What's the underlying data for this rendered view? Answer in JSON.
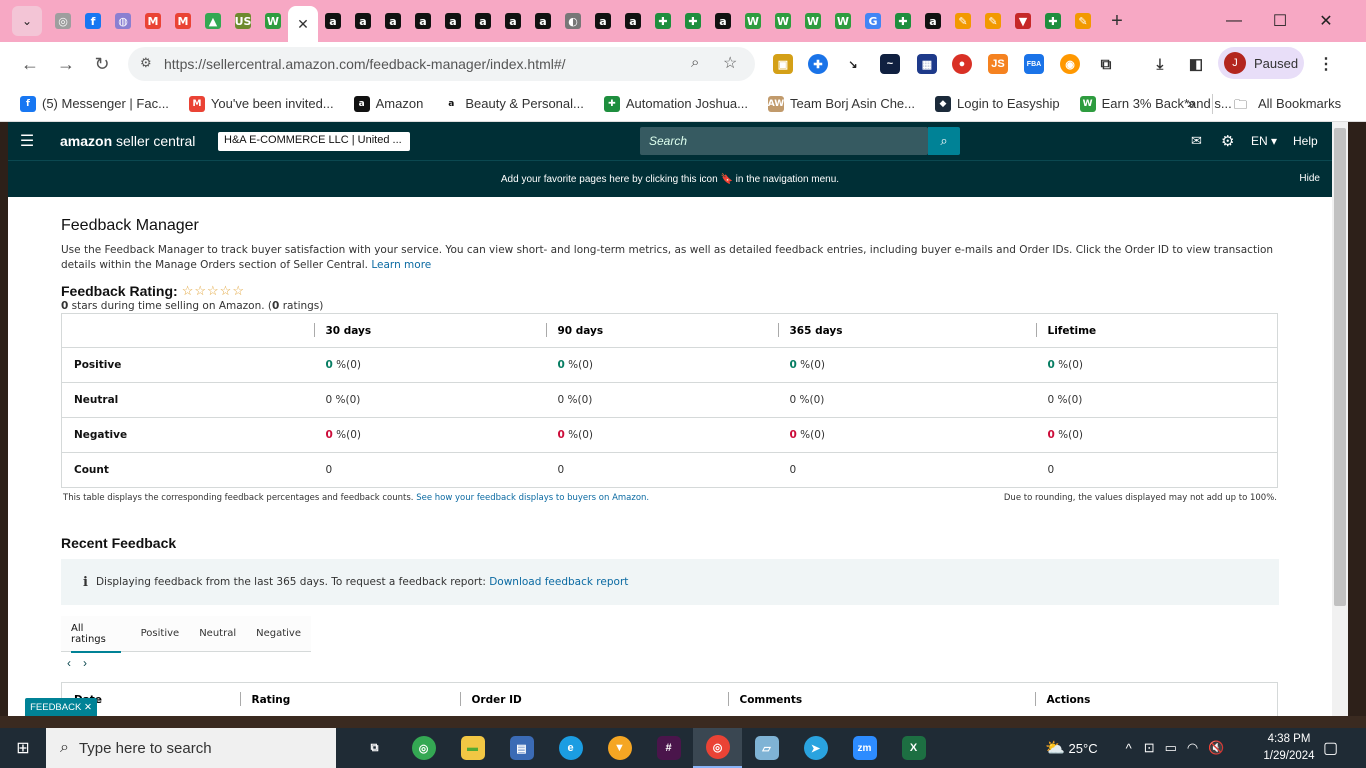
{
  "browser": {
    "tab_icons": [
      "chrome",
      "facebook",
      "messenger",
      "gmail",
      "gmail",
      "drive",
      "usfoods",
      "wealthy",
      "amazon",
      "amazon",
      "amazon",
      "amazon",
      "amazon",
      "amazon",
      "amazon",
      "amazon",
      "globe",
      "amazon",
      "amazon",
      "sheets",
      "sheets",
      "amazon",
      "wealthy",
      "wealthy",
      "wealthy",
      "wealthy",
      "google",
      "sheets",
      "amazon",
      "pencil",
      "pencil",
      "vpn",
      "sheets",
      "pencil"
    ],
    "active_tab_close": "✕",
    "new_tab": "+",
    "url": "https://sellercentral.amazon.com/feedback-manager/index.html#/",
    "profile_initial": "J",
    "profile_status": "Paused",
    "bookmarks": [
      {
        "icon": "facebook",
        "label": "(5) Messenger | Fac..."
      },
      {
        "icon": "gmail",
        "label": "You've been invited..."
      },
      {
        "icon": "amazon",
        "label": "Amazon"
      },
      {
        "icon": "amazon-smile",
        "label": "Beauty & Personal..."
      },
      {
        "icon": "sheets",
        "label": "Automation Joshua..."
      },
      {
        "icon": "team",
        "label": "Team Borj Asin Che..."
      },
      {
        "icon": "easyship",
        "label": "Login to Easyship"
      },
      {
        "icon": "wealthy",
        "label": "Earn 3% Back*and s..."
      }
    ],
    "all_bookmarks": "All Bookmarks",
    "more": "»"
  },
  "seller_central": {
    "logo_brand": "amazon",
    "logo_text": "seller central",
    "store": "H&A E-COMMERCE LLC | United ...",
    "search_placeholder": "Search",
    "language": "EN",
    "help": "Help",
    "fav_bar_text": "Add your favorite pages here by clicking this icon 🔖 in the navigation menu.",
    "fav_bar_hide": "Hide"
  },
  "feedback_manager": {
    "title": "Feedback Manager",
    "description": "Use the Feedback Manager to track buyer satisfaction with your service. You can view short- and long-term metrics, as well as detailed feedback entries, including buyer e-mails and Order IDs. Click the Order ID to view transaction details within the Manage Orders section of Seller Central.",
    "learn_more": "Learn more",
    "rating_label": "Feedback Rating:",
    "stars": "☆☆☆☆☆",
    "rating_count": "0",
    "rating_sub_text": " stars during time selling on Amazon. (",
    "ratings_num": "0",
    "ratings_word": " ratings)",
    "columns": [
      "",
      "30 days",
      "90 days",
      "365 days",
      "Lifetime"
    ],
    "rows": [
      {
        "label": "Positive",
        "values": [
          "0",
          "0",
          "0",
          "0"
        ],
        "suffix": " %(0)"
      },
      {
        "label": "Neutral",
        "values": [
          "0",
          "0",
          "0",
          "0"
        ],
        "suffix": " %(0)"
      },
      {
        "label": "Negative",
        "values": [
          "0",
          "0",
          "0",
          "0"
        ],
        "suffix": " %(0)"
      },
      {
        "label": "Count",
        "values": [
          "0",
          "0",
          "0",
          "0"
        ],
        "suffix": ""
      }
    ],
    "note_left": "This table displays the corresponding feedback percentages and feedback counts.",
    "note_left_link": "See how your feedback displays to buyers on Amazon.",
    "note_right": "Due to rounding, the values displayed may not add up to 100%.",
    "recent_title": "Recent Feedback",
    "info_text": "Displaying feedback from the last 365 days. To request a feedback report:",
    "info_link": "Download feedback report",
    "tabs": [
      "All ratings",
      "Positive",
      "Neutral",
      "Negative"
    ],
    "recent_columns": [
      "Date",
      "Rating",
      "Order ID",
      "Comments",
      "Actions"
    ],
    "feedback_tag": "FEEDBACK ✕"
  },
  "taskbar": {
    "search_placeholder": "Type here to search",
    "weather": "25°C",
    "time": "4:38 PM",
    "date": "1/29/2024"
  },
  "colors": {
    "tab_strip": "#f7a8c4",
    "sc_header": "#002f36",
    "accent": "#008296",
    "positive": "#067d62",
    "negative": "#cc0c39"
  }
}
